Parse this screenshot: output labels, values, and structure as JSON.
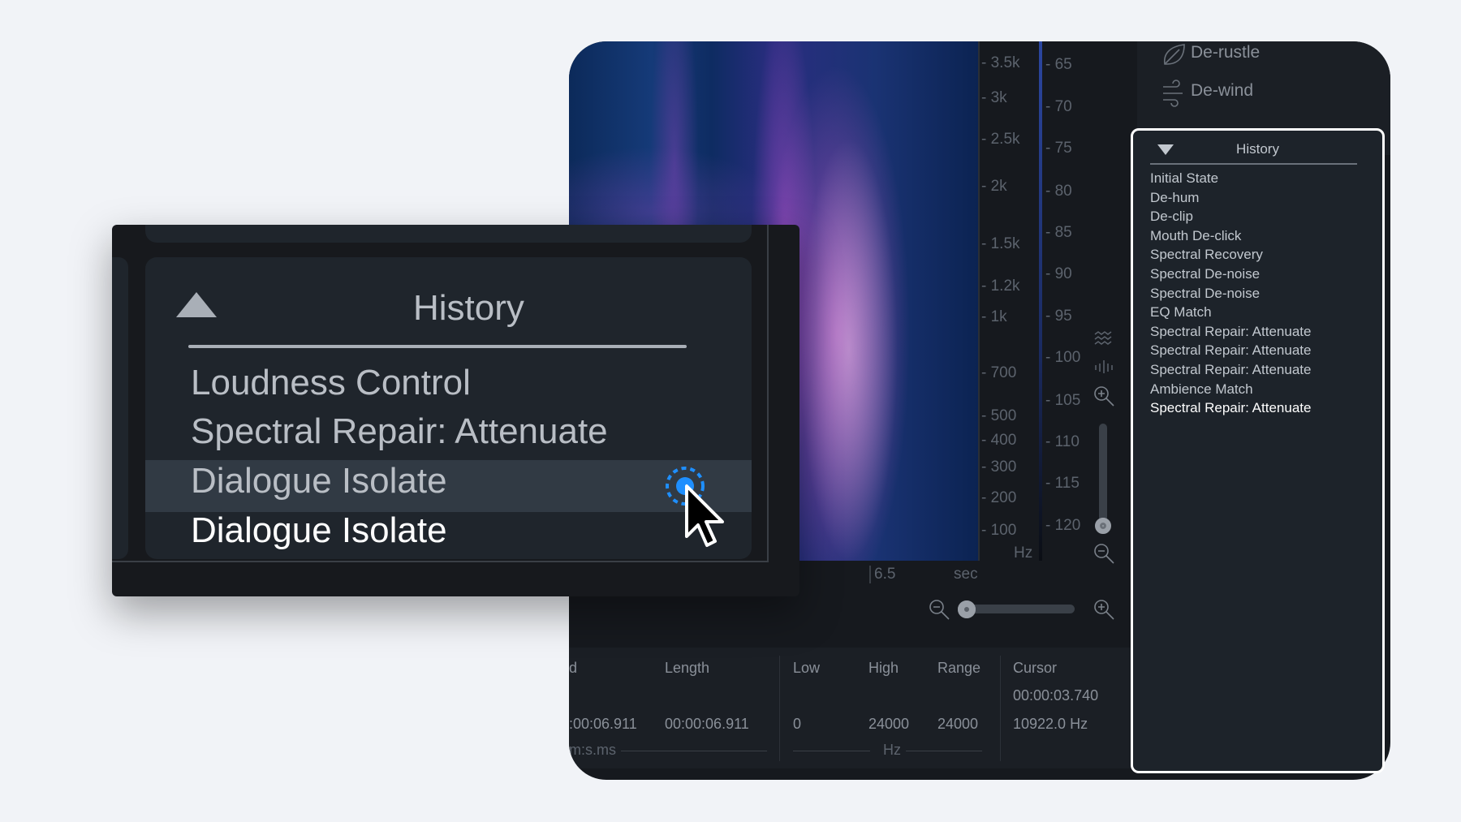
{
  "modules": [
    {
      "label": "De-rustle",
      "icon": "leaf-icon"
    },
    {
      "label": "De-wind",
      "icon": "wind-icon"
    }
  ],
  "spectrogram": {
    "freq_ticks": [
      "3.5k",
      "3k",
      "2.5k",
      "2k",
      "1.5k",
      "1.2k",
      "1k",
      "700",
      "500",
      "400",
      "300",
      "200",
      "100"
    ],
    "freq_unit": "Hz",
    "db_ticks": [
      "65",
      "70",
      "75",
      "80",
      "85",
      "90",
      "95",
      "100",
      "105",
      "110",
      "115",
      "120"
    ],
    "time_tick": "6.5",
    "time_unit": "sec"
  },
  "info": {
    "headers": [
      "d",
      "Length",
      "Low",
      "High",
      "Range",
      "Cursor"
    ],
    "start": ":00:06.911",
    "length": "00:00:06.911",
    "time_unit": "m:s.ms",
    "low": "0",
    "high": "24000",
    "range": "24000",
    "freq_unit": "Hz",
    "cursor_time": "00:00:03.740",
    "cursor_freq": "10922.0 Hz"
  },
  "history": {
    "title": "History",
    "items": [
      "Initial State",
      "De-hum",
      "De-clip",
      "Mouth De-click",
      "Spectral Recovery",
      "Spectral De-noise",
      "Spectral De-noise",
      "EQ Match",
      "Spectral Repair: Attenuate",
      "Spectral Repair: Attenuate",
      "Spectral Repair: Attenuate",
      "Ambience Match",
      "Spectral Repair: Attenuate"
    ]
  },
  "popup": {
    "title": "History",
    "items": [
      "Loudness Control",
      "Spectral Repair: Attenuate",
      "Dialogue Isolate",
      "Dialogue Isolate"
    ],
    "accent": "#1e8fff"
  }
}
